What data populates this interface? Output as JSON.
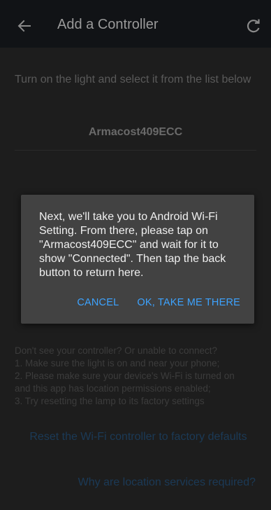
{
  "appbar": {
    "title": "Add a Controller",
    "back_icon": "arrow-left-icon",
    "refresh_icon": "refresh-icon"
  },
  "content": {
    "instruction": "Turn on the light and select it from the list below",
    "devices": [
      {
        "name": "Armacost409ECC"
      }
    ],
    "help_lines": [
      "Don't see your controller? Or unable to connect?",
      "1. Make sure the light is on and near your phone;",
      "2. Please make sure your device's Wi-Fi is turned on",
      "and this app has location permissions enabled;",
      "3. Try resetting the lamp to its factory settings"
    ],
    "reset_link": "Reset the Wi-Fi controller to factory defaults",
    "location_link": "Why are location services required?"
  },
  "dialog": {
    "message": "Next, we'll take you to Android Wi-Fi Setting. From there, please tap on \"Armacost409ECC\" and wait for it to show \"Connected\". Then tap the back button to return here.",
    "cancel_label": "CANCEL",
    "ok_label": "OK, TAKE ME THERE"
  },
  "colors": {
    "accent": "#3da3ff",
    "dialog_bg": "#424242",
    "appbar_bg": "#111316"
  }
}
